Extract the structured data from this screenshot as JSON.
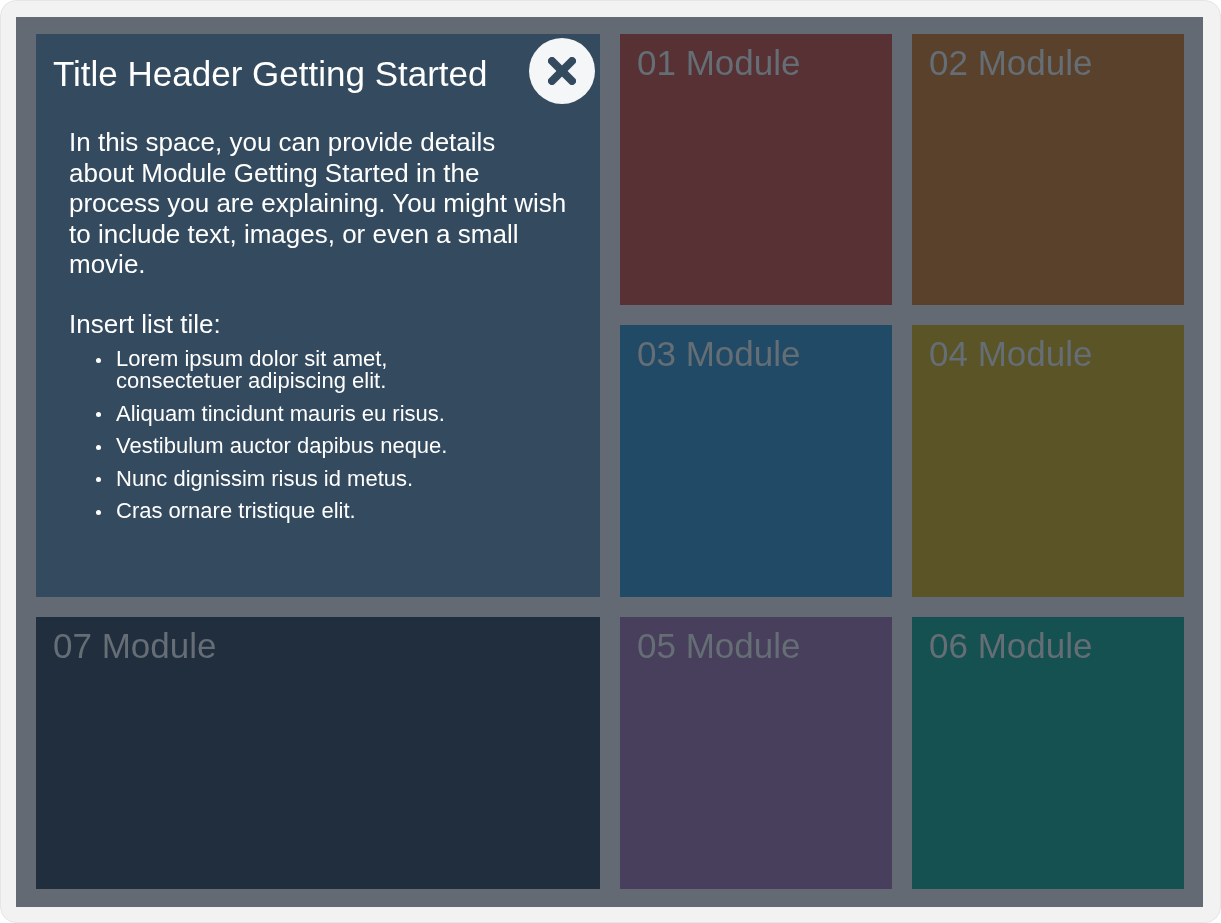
{
  "detail_panel": {
    "title": "Title Header Getting Started",
    "text": "In this space, you can provide details\nabout Module Getting Started in the\nprocess you are explaining. You might wish\nto include text, images, or even a small\nmovie.",
    "list_title": "Insert list tile:",
    "list_items": [
      "Lorem ipsum dolor sit amet, consectetuer adipiscing elit.",
      "Aliquam tincidunt mauris eu risus.",
      "Vestibulum auctor dapibus neque.",
      "Nunc dignissim risus id metus.",
      "Cras ornare tristique elit."
    ]
  },
  "modules": [
    {
      "label": "01 Module",
      "color": "#573134"
    },
    {
      "label": "02 Module",
      "color": "#5a412c"
    },
    {
      "label": "03 Module",
      "color": "#214a66"
    },
    {
      "label": "04 Module",
      "color": "#5b5427"
    },
    {
      "label": "07 Module",
      "color": "#202e3e"
    },
    {
      "label": "05 Module",
      "color": "#473f5c"
    },
    {
      "label": "06 Module",
      "color": "#145150"
    }
  ]
}
